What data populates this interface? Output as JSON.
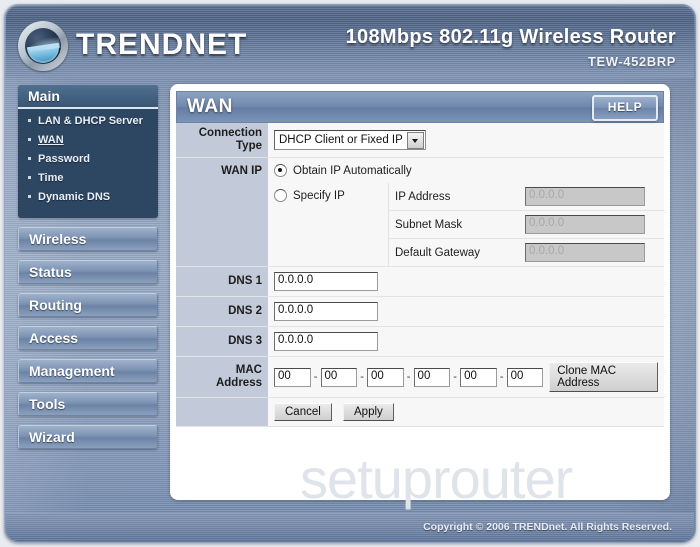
{
  "header": {
    "brand": "TRENDNET",
    "product_title": "108Mbps 802.11g Wireless Router",
    "model": "TEW-452BRP",
    "logo_icon": "trendnet-globe-icon"
  },
  "sidebar": {
    "main_group": {
      "title": "Main",
      "items": [
        {
          "label": "LAN & DHCP Server",
          "active": false
        },
        {
          "label": "WAN",
          "active": true
        },
        {
          "label": "Password",
          "active": false
        },
        {
          "label": "Time",
          "active": false
        },
        {
          "label": "Dynamic DNS",
          "active": false
        }
      ]
    },
    "buttons": [
      {
        "label": "Wireless"
      },
      {
        "label": "Status"
      },
      {
        "label": "Routing"
      },
      {
        "label": "Access"
      },
      {
        "label": "Management"
      },
      {
        "label": "Tools"
      },
      {
        "label": "Wizard"
      }
    ]
  },
  "panel": {
    "title": "WAN",
    "help_label": "HELP",
    "connection_type": {
      "label": "Connection Type",
      "selected": "DHCP Client or Fixed IP"
    },
    "wan_ip": {
      "label": "WAN IP",
      "option_auto": "Obtain IP Automatically",
      "option_auto_selected": true,
      "option_specify": "Specify IP",
      "option_specify_selected": false,
      "fields": [
        {
          "label": "IP Address",
          "value": "0.0.0.0",
          "disabled": true
        },
        {
          "label": "Subnet Mask",
          "value": "0.0.0.0",
          "disabled": true
        },
        {
          "label": "Default Gateway",
          "value": "0.0.0.0",
          "disabled": true
        }
      ]
    },
    "dns": [
      {
        "label": "DNS 1",
        "value": "0.0.0.0"
      },
      {
        "label": "DNS 2",
        "value": "0.0.0.0"
      },
      {
        "label": "DNS 3",
        "value": "0.0.0.0"
      }
    ],
    "mac": {
      "label": "MAC Address",
      "label_line1": "MAC",
      "label_line2": "Address",
      "octets": [
        "00",
        "00",
        "00",
        "00",
        "00",
        "00"
      ],
      "separator": "-",
      "clone_label": "Clone MAC Address"
    },
    "actions": {
      "cancel_label": "Cancel",
      "apply_label": "Apply"
    }
  },
  "watermark": "setuprouter",
  "footer": {
    "copyright": "Copyright © 2006 TRENDnet. All Rights Reserved."
  }
}
